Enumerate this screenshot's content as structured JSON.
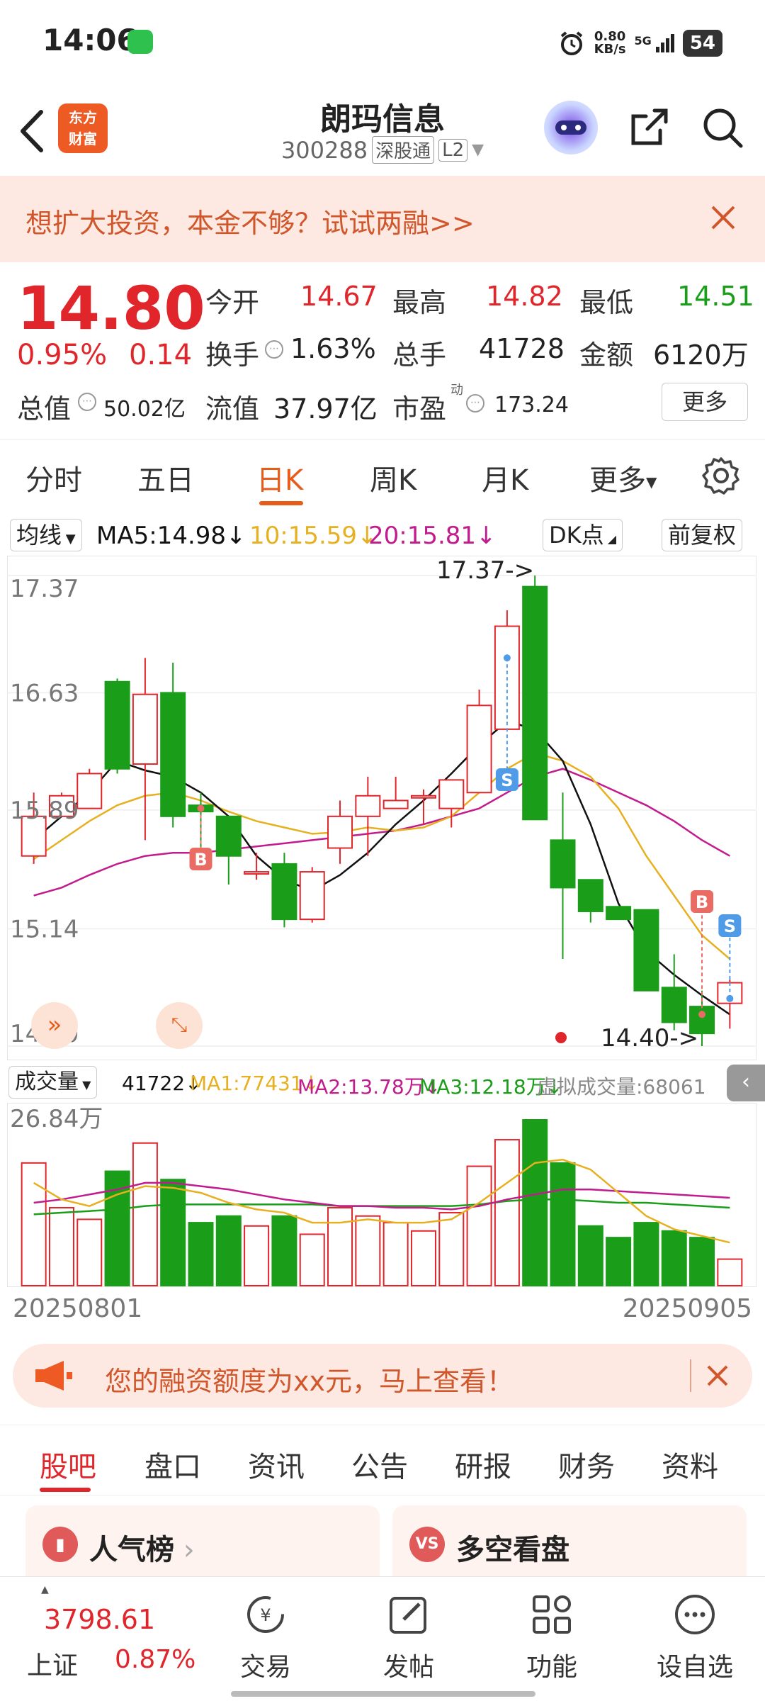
{
  "status_bar": {
    "time": "14:06",
    "speed": "0.80",
    "speed_unit": "KB/s",
    "network": "5G",
    "battery": "54"
  },
  "header": {
    "stock_name": "朗玛信息",
    "stock_code": "300288",
    "tag_connect": "深股通",
    "tag_level": "L2",
    "logo_line1": "东方",
    "logo_line2": "财富"
  },
  "promo": {
    "text": "想扩大投资，本金不够？试试两融>>"
  },
  "quote": {
    "price": "14.80",
    "change_pct": "0.95%",
    "change": "0.14",
    "open_label": "今开",
    "open": "14.67",
    "high_label": "最高",
    "high": "14.82",
    "low_label": "最低",
    "low": "14.51",
    "turnover_label": "换手",
    "turnover": "1.63%",
    "volume_label": "总手",
    "volume": "41728",
    "amount_label": "金额",
    "amount": "6120万",
    "mcap_label": "总值",
    "mcap": "50.02亿",
    "float_label": "流值",
    "float": "37.97亿",
    "pe_label": "市盈",
    "pe_sup": "动",
    "pe": "173.24",
    "more": "更多"
  },
  "period_tabs": [
    "分时",
    "五日",
    "日K",
    "周K",
    "月K",
    "更多"
  ],
  "ma_row": {
    "selector": "均线",
    "ma5": "MA5:14.98",
    "ma10": "10:15.59",
    "ma20": "20:15.81",
    "dk": "DK点",
    "adjust": "前复权"
  },
  "chart_data": {
    "type": "candlestick",
    "price_ticks": [
      "17.37",
      "16.63",
      "15.89",
      "15.14",
      "14.40"
    ],
    "ylim": [
      14.4,
      17.37
    ],
    "annotations": {
      "high": "17.37->",
      "low": "14.40->"
    },
    "markers": {
      "buy": "B",
      "sell": "S"
    },
    "candles": [
      [
        15.6,
        15.85,
        15.55,
        16.0
      ],
      [
        15.85,
        15.98,
        15.85,
        16.0
      ],
      [
        15.9,
        16.12,
        15.9,
        16.15
      ],
      [
        16.7,
        16.15,
        16.12,
        16.72
      ],
      [
        16.18,
        16.62,
        15.7,
        16.85
      ],
      [
        16.63,
        15.85,
        15.78,
        16.82
      ],
      [
        15.92,
        15.88,
        15.65,
        16.0
      ],
      [
        15.85,
        15.6,
        15.42,
        15.85
      ],
      [
        15.5,
        15.5,
        15.45,
        15.62
      ],
      [
        15.55,
        15.2,
        15.15,
        15.62
      ],
      [
        15.2,
        15.5,
        15.18,
        15.53
      ],
      [
        15.65,
        15.85,
        15.55,
        15.95
      ],
      [
        15.85,
        15.98,
        15.6,
        16.1
      ],
      [
        15.9,
        15.95,
        15.9,
        16.1
      ],
      [
        15.98,
        15.98,
        15.8,
        16.02
      ],
      [
        15.9,
        16.08,
        15.78,
        16.08
      ],
      [
        16.0,
        16.55,
        16.0,
        16.65
      ],
      [
        16.4,
        17.05,
        16.4,
        17.15
      ],
      [
        17.3,
        15.83,
        15.83,
        17.37
      ],
      [
        15.7,
        15.4,
        14.95,
        16.0
      ],
      [
        15.45,
        15.25,
        15.18,
        15.45
      ],
      [
        15.28,
        15.2,
        15.2,
        15.28
      ],
      [
        15.26,
        14.75,
        14.75,
        15.26
      ],
      [
        14.77,
        14.55,
        14.5,
        14.98
      ],
      [
        14.65,
        14.48,
        14.4,
        14.75
      ],
      [
        14.67,
        14.8,
        14.51,
        14.82
      ]
    ],
    "ma_lines": {
      "ma5": [
        15.7,
        15.85,
        16.0,
        16.2,
        16.14,
        16.1,
        16.0,
        15.85,
        15.6,
        15.45,
        15.38,
        15.48,
        15.62,
        15.8,
        15.95,
        16.12,
        16.3,
        16.45,
        16.4,
        16.2,
        15.8,
        15.3,
        15.0,
        14.85,
        14.72,
        14.6
      ],
      "ma10": [
        15.58,
        15.7,
        15.82,
        15.92,
        15.98,
        16.0,
        15.95,
        15.88,
        15.82,
        15.78,
        15.74,
        15.75,
        15.78,
        15.76,
        15.78,
        15.85,
        16.0,
        16.15,
        16.25,
        16.2,
        16.1,
        15.9,
        15.6,
        15.35,
        15.1,
        14.95
      ],
      "ma20": [
        15.35,
        15.4,
        15.48,
        15.55,
        15.6,
        15.62,
        15.62,
        15.64,
        15.66,
        15.68,
        15.7,
        15.72,
        15.74,
        15.76,
        15.8,
        15.85,
        15.9,
        16.0,
        16.1,
        16.15,
        16.08,
        16.0,
        15.92,
        15.82,
        15.7,
        15.6
      ]
    },
    "volume": {
      "selector": "成交量",
      "value": "41722",
      "ma1": "MA1:77431",
      "ma2": "MA2:13.78万",
      "ma3": "MA3:12.18万",
      "virtual": "虚拟成交量:68061",
      "top_tick": "26.84万",
      "bars": [
        0.74,
        0.47,
        0.4,
        0.69,
        0.86,
        0.64,
        0.38,
        0.42,
        0.36,
        0.42,
        0.31,
        0.47,
        0.42,
        0.38,
        0.33,
        0.44,
        0.72,
        0.88,
        1.0,
        0.74,
        0.36,
        0.29,
        0.38,
        0.33,
        0.29,
        0.16
      ],
      "ma1_line": [
        0.62,
        0.52,
        0.48,
        0.55,
        0.6,
        0.59,
        0.56,
        0.5,
        0.46,
        0.44,
        0.38,
        0.38,
        0.4,
        0.38,
        0.38,
        0.4,
        0.5,
        0.62,
        0.74,
        0.76,
        0.7,
        0.56,
        0.42,
        0.34,
        0.3,
        0.26
      ],
      "ma2_line": [
        0.5,
        0.52,
        0.55,
        0.58,
        0.62,
        0.62,
        0.6,
        0.58,
        0.55,
        0.52,
        0.5,
        0.48,
        0.48,
        0.47,
        0.47,
        0.46,
        0.48,
        0.52,
        0.55,
        0.58,
        0.58,
        0.57,
        0.56,
        0.55,
        0.54,
        0.53
      ],
      "ma3_line": [
        0.43,
        0.44,
        0.45,
        0.46,
        0.48,
        0.49,
        0.49,
        0.49,
        0.49,
        0.49,
        0.49,
        0.48,
        0.48,
        0.48,
        0.48,
        0.48,
        0.49,
        0.51,
        0.52,
        0.52,
        0.51,
        0.5,
        0.5,
        0.49,
        0.48,
        0.47
      ]
    },
    "dates": {
      "start": "20250801",
      "end": "20250905"
    }
  },
  "finance_banner": {
    "text": "您的融资额度为xx元，马上查看！"
  },
  "content_tabs": [
    "股吧",
    "盘口",
    "资讯",
    "公告",
    "研报",
    "财务",
    "资料"
  ],
  "cards": {
    "left": "人气榜",
    "right": "多空看盘"
  },
  "bottom_nav": {
    "index_value": "3798.61",
    "index_name": "上证",
    "index_pct": "0.87%",
    "items": [
      "交易",
      "发帖",
      "功能",
      "设自选"
    ]
  },
  "colors": {
    "up": "#e0252b",
    "down": "#1a9e1a",
    "accent": "#e85c1a",
    "ma5": "#111111",
    "ma10": "#e6b020",
    "ma20": "#c21b8e"
  }
}
